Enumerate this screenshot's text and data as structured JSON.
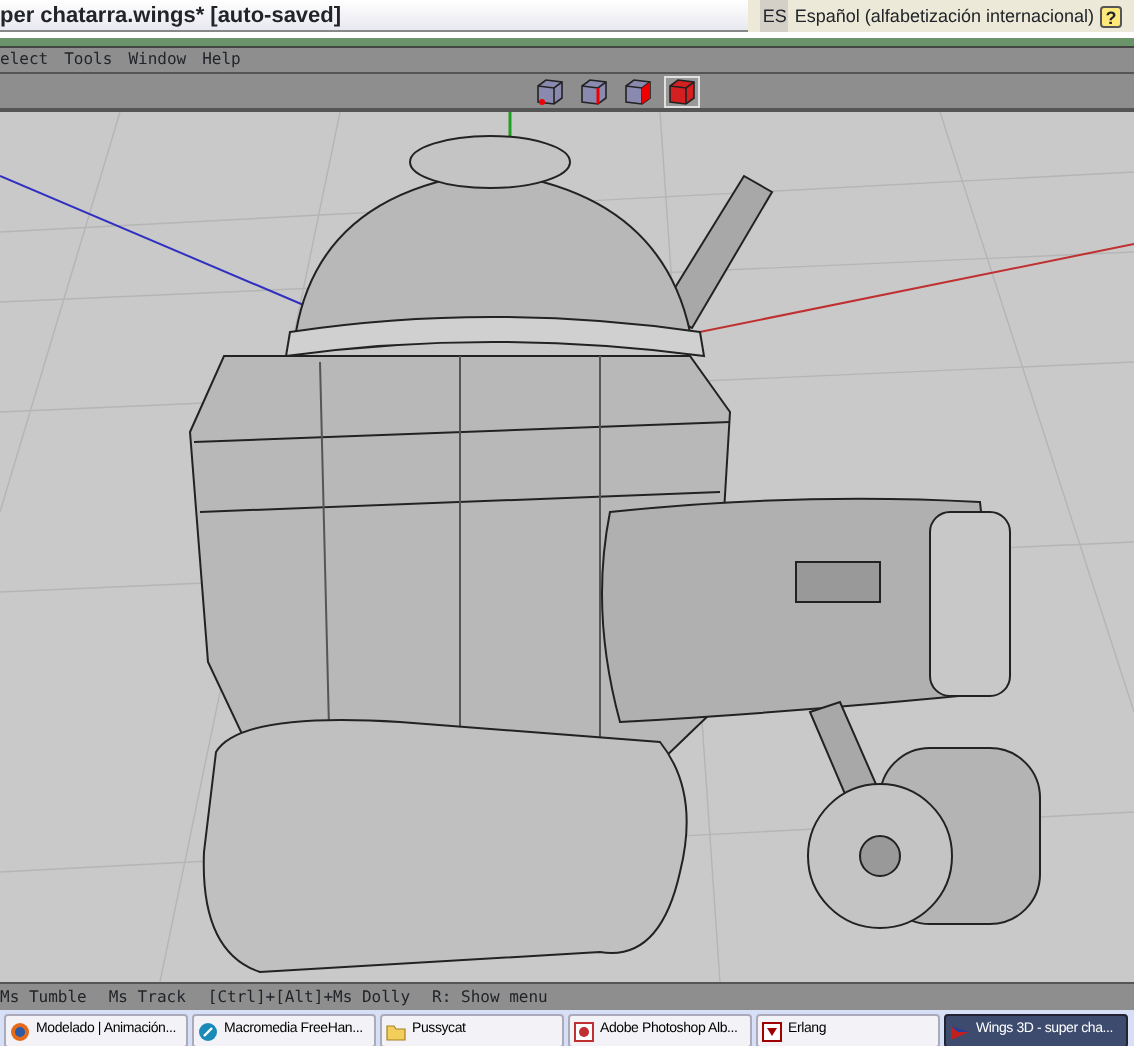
{
  "window": {
    "title": "per chatarra.wings* [auto-saved]"
  },
  "language_bar": {
    "code": "ES",
    "language": "Español (alfabetización internacional)",
    "help": "?"
  },
  "menu": [
    "elect",
    "Tools",
    "Window",
    "Help"
  ],
  "selection_modes": [
    {
      "kind": "vertex",
      "selected": false
    },
    {
      "kind": "edge",
      "selected": false
    },
    {
      "kind": "face",
      "selected": false
    },
    {
      "kind": "body",
      "selected": true
    }
  ],
  "status_bar": [
    "Ms Tumble",
    "Ms Track",
    "[Ctrl]+[Alt]+Ms Dolly",
    "R: Show menu"
  ],
  "taskbar": [
    {
      "kind": "browser",
      "label": "Modelado | Animación...",
      "selected": false
    },
    {
      "kind": "flash",
      "label": "Macromedia FreeHan...",
      "selected": false
    },
    {
      "kind": "folder",
      "label": "Pussycat",
      "selected": false
    },
    {
      "kind": "photo",
      "label": "Adobe Photoshop Alb...",
      "selected": false
    },
    {
      "kind": "erlang",
      "label": "Erlang",
      "selected": false
    },
    {
      "kind": "wings",
      "label": "Wings 3D - super cha...",
      "selected": true
    }
  ]
}
